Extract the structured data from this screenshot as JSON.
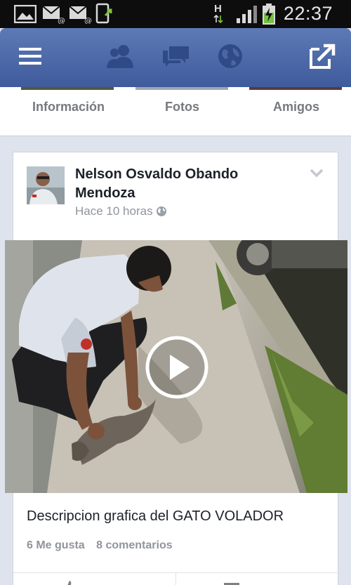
{
  "status_bar": {
    "time": "22:37",
    "network": "H",
    "icons": [
      "gallery-icon",
      "email-icon",
      "email-icon",
      "screenshot-icon",
      "signal-icon",
      "battery-charging-icon"
    ]
  },
  "nav": {
    "items": [
      "menu-icon",
      "friend-requests-icon",
      "messages-icon",
      "notifications-globe-icon",
      "share-icon"
    ]
  },
  "profile_tabs": [
    "Información",
    "Fotos",
    "Amigos"
  ],
  "post": {
    "author": "Nelson Osvaldo Obando Mendoza",
    "time": "Hace 10 horas",
    "description": "Descripcion grafica del GATO VOLADOR",
    "likes": "6 Me gusta",
    "comments": "8 comentarios"
  },
  "colors": {
    "fb_blue": "#3f5b9b",
    "background": "#dfe3ee",
    "muted_text": "#90949c"
  }
}
